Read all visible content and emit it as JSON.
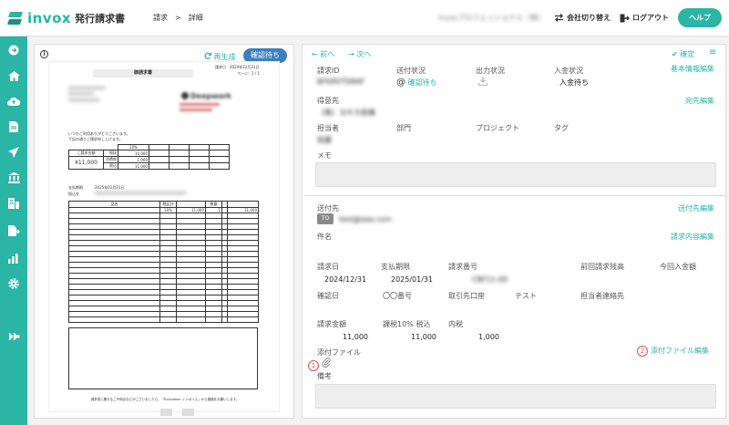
{
  "app": {
    "name": "invox",
    "subtitle": "発行請求書",
    "breadcrumb": [
      "請求",
      ">",
      "詳細"
    ],
    "company_name_blurred": "invoxプロフェッショナル（株）",
    "switch_company_label": "会社切り替え",
    "logout_label": "ログアウト",
    "help_label": "ヘルプ",
    "accent_color": "#2ab5a5"
  },
  "sidebar": {
    "icons": [
      "arrow-right-circle-icon",
      "home-icon",
      "cloud-upload-icon",
      "document-icon",
      "send-icon",
      "bank-icon",
      "building-icon",
      "document-export-icon",
      "chart-icon",
      "settings-gear-icon",
      "plugin-icon"
    ]
  },
  "preview": {
    "regenerate_label": "再生成",
    "status_button": "確認待ち",
    "document": {
      "title": "御請求書",
      "issue_date_label": "請求日",
      "issue_date": "2024年12月31日",
      "page_label": "ページ：1 / 1",
      "company_logo_text": "Deepwork",
      "greeting_line1": "いつもご利用ありがとうございます。",
      "greeting_line2": "下記の通りご請求申し上げます。",
      "amount_label": "ご請求金額",
      "amount": "¥11,000",
      "tax_rate": "10%",
      "subtotal_label": "税抜",
      "subtotal": "10,000",
      "tax_label": "消費税",
      "tax": "1,000",
      "total_label": "税込",
      "total": "11,000",
      "due_label": "支払期限",
      "due_date": "2025年01月31日",
      "bank_label": "振込先",
      "item_header_name": "品名",
      "item_header_tax": "税区分",
      "item_header_qty": "数量",
      "item_row_tax": "10%",
      "item_row_price": "11,000",
      "item_row_qty": "1",
      "item_row_amount": "11,000",
      "bottom_note": "請求書に関するご不明点などがございましたら、「Evaluation インボイス」から連絡をお願いします。"
    }
  },
  "detail": {
    "nav_prev": "前へ",
    "nav_next": "次へ",
    "confirm_label": "確定",
    "basic_info_edit": "基本情報編集",
    "invoice_id_label": "請求ID",
    "invoice_id_value": "BFKRVTD8AF",
    "send_status_label": "送付状況",
    "send_status_value": "確認待ち",
    "output_status_label": "出力状況",
    "payment_status_label": "入金状況",
    "payment_status_value": "入金待ち",
    "customer_label": "得意先",
    "customer_value": "（株）ヨキカ商事",
    "destination_edit": "宛先編集",
    "person_label": "担当者",
    "person_value": "佐藤",
    "dept_label": "部門",
    "project_label": "プロジェクト",
    "tag_label": "タグ",
    "memo_label": "メモ",
    "send_to_label": "送付先",
    "send_to_edit": "送付先編集",
    "to_badge": "TO",
    "to_email": "test@aaa.com",
    "subject_label": "件名",
    "invoice_content_edit": "請求内容編集",
    "invoice_date_label": "請求日",
    "invoice_date_value": "2024/12/31",
    "due_date_label": "支払期限",
    "due_date_value": "2025/01/31",
    "invoice_number_label": "請求番号",
    "invoice_number_value": "CBF11-00",
    "prev_balance_label": "前回請求残高",
    "current_received_label": "今回入金額",
    "confirm_date_label": "確認日",
    "number_label": "〇〇番号",
    "account_label": "取引先口座",
    "test_label": "テスト",
    "contact_label": "担当者連絡先",
    "amount_label": "請求金額",
    "amount_value": "11,000",
    "tax10_label": "課税10% 税込",
    "tax10_value": "11,000",
    "internal_tax_label": "内税",
    "internal_tax_value": "1,000",
    "attachment_label": "添付ファイル",
    "attachment_edit": "添付ファイル編集",
    "marker1": "1",
    "marker2": "2",
    "remarks_label": "備考"
  }
}
